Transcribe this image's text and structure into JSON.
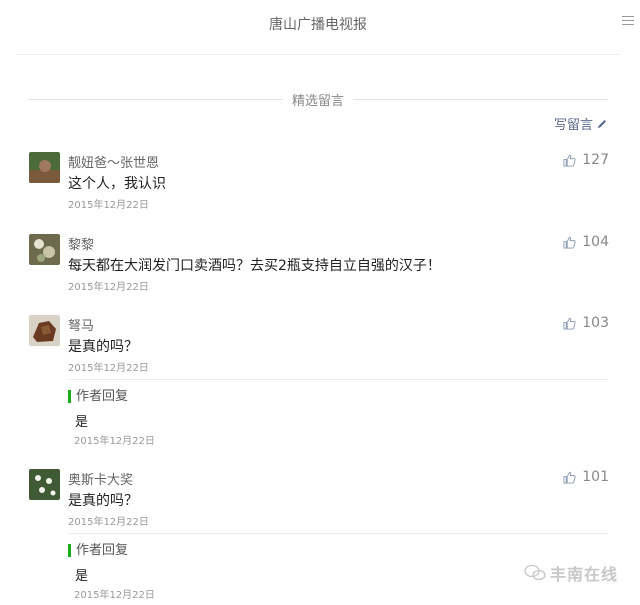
{
  "header": {
    "title": "唐山广播电视报"
  },
  "section": {
    "title": "精选留言"
  },
  "write_comment": {
    "label": "写留言"
  },
  "comments": [
    {
      "nickname": "靓妞爸～张世恩",
      "content": "这个人，我认识",
      "date": "2015年12月22日",
      "likes": "127"
    },
    {
      "nickname": "黎黎",
      "content": "每天都在大润发门口卖酒吗？去买2瓶支持自立自强的汉子！",
      "date": "2015年12月22日",
      "likes": "104"
    },
    {
      "nickname": "弩马",
      "content": "是真的吗？",
      "date": "2015年12月22日",
      "likes": "103",
      "reply": {
        "label": "作者回复",
        "content": "是",
        "date": "2015年12月22日"
      }
    },
    {
      "nickname": "奥斯卡大奖",
      "content": "是真的吗？",
      "date": "2015年12月22日",
      "likes": "101",
      "reply": {
        "label": "作者回复",
        "content": "是",
        "date": "2015年12月22日"
      }
    }
  ],
  "watermark": {
    "text": "丰南在线"
  }
}
